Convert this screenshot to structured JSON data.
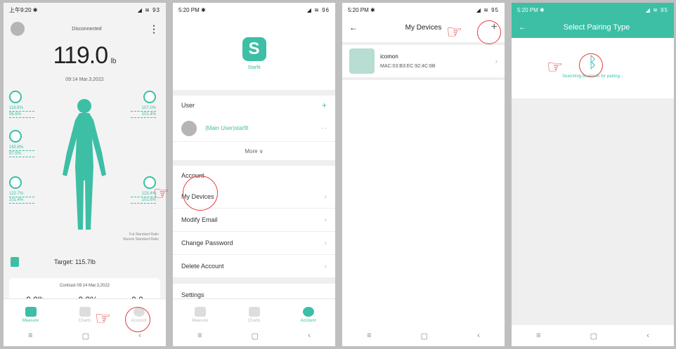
{
  "panel1": {
    "status_time": "上午9:20 ✱",
    "status_right": "◢ ≋ 93",
    "connection": "Disconnected",
    "menu_icon": "kebab-icon",
    "weight_value": "119.0",
    "weight_unit": "lb",
    "date": "09:14 Mar.3,2022",
    "metrics": [
      {
        "a": "116.8%",
        "b": "96.6%"
      },
      {
        "a": "107.0%",
        "b": "101.4%"
      },
      {
        "a": "160.8%",
        "b": "97.5%"
      },
      {
        "a": "122.7%",
        "b": "101.4%"
      },
      {
        "a": "123.4%",
        "b": "101.6%"
      }
    ],
    "legend_fat": "Fat Standard Ratio",
    "legend_muscle": "Muscle Standard Ratio",
    "target": "Target: 115.7lb",
    "contrast_title": "Contrast 09:14 Mar.3,2022",
    "contrast_values": [
      "0.0lb",
      "0.0%",
      "0.0"
    ],
    "tabs": [
      "Measure",
      "Charts",
      "Account"
    ]
  },
  "panel2": {
    "status_time": "5:20 PM ✱",
    "status_right": "◢ ≋ 96",
    "app_name": "Starfit",
    "user_section": "User",
    "user_name": "(Main User)starfit",
    "user_dash": "- -",
    "more": "More ∨",
    "account_section": "Account",
    "rows": [
      "My Devices",
      "Modify Email",
      "Change Password",
      "Delete Account"
    ],
    "settings": "Settings",
    "tabs": [
      "Measure",
      "Charts",
      "Account"
    ]
  },
  "panel3": {
    "status_time": "5:20 PM ✱",
    "status_right": "◢ ≋ 95",
    "title": "My Devices",
    "device_name": "icomon",
    "device_mac": "MAC:03:B3:EC:92:4C:6B"
  },
  "panel4": {
    "status_time": "5:20 PM ✱",
    "status_right": "◢ ≋ 95",
    "title": "Select Pairing Type",
    "searching": "Searching bluetooth for pairing..."
  },
  "nav_keys": [
    "≡",
    "▢",
    "‹"
  ],
  "colors": {
    "accent": "#3cbfa5",
    "highlight": "#e8393b"
  }
}
